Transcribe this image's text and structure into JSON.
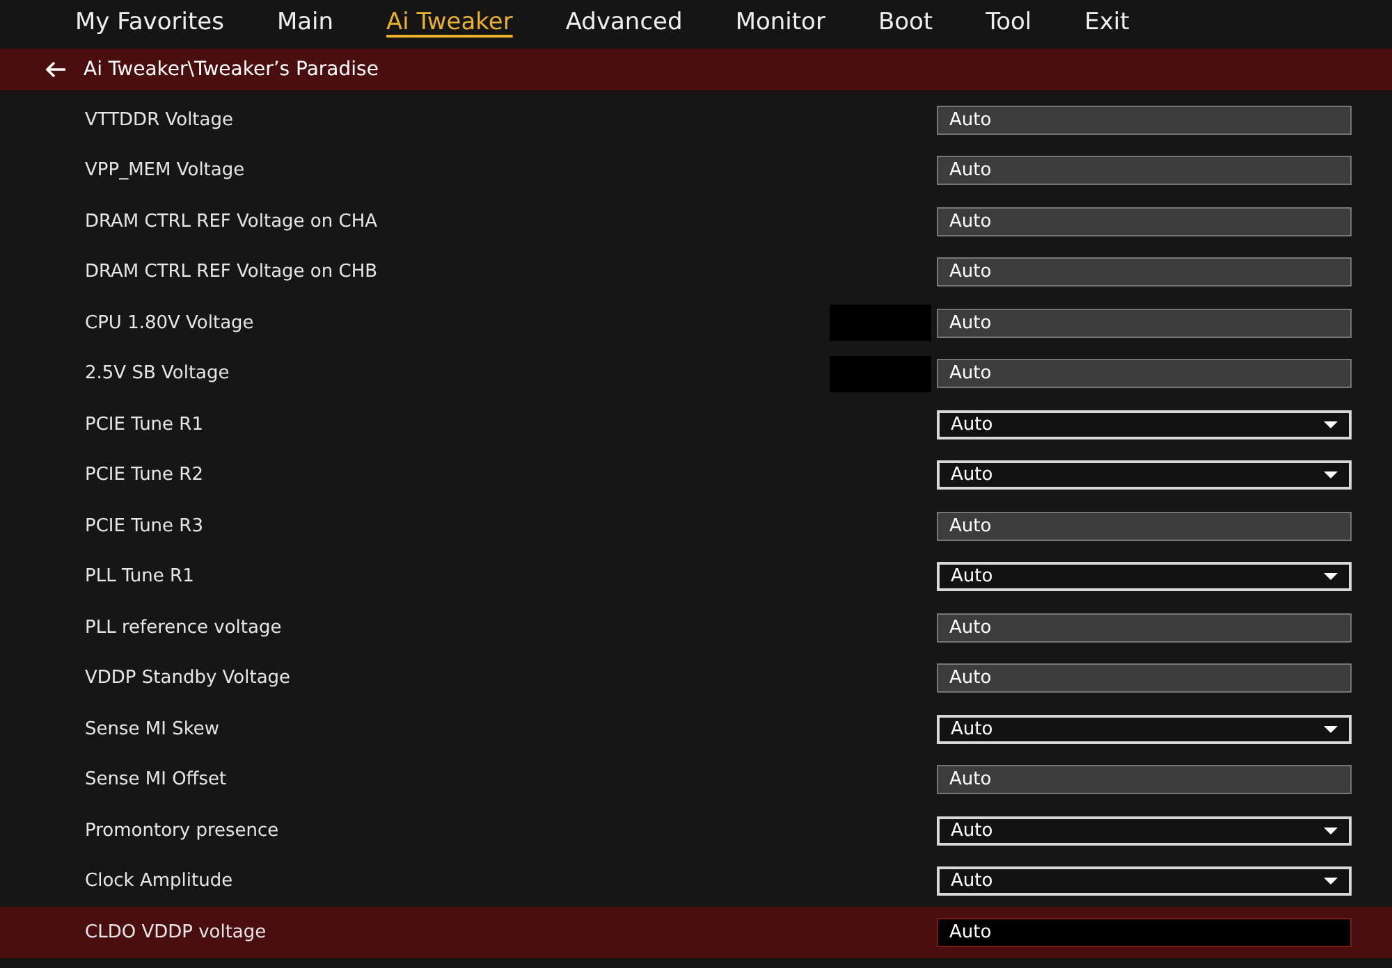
{
  "menu": [
    {
      "label": "My Favorites",
      "selected": false
    },
    {
      "label": "Main",
      "selected": false
    },
    {
      "label": "Ai Tweaker",
      "selected": true
    },
    {
      "label": "Advanced",
      "selected": false
    },
    {
      "label": "Monitor",
      "selected": false
    },
    {
      "label": "Boot",
      "selected": false
    },
    {
      "label": "Tool",
      "selected": false
    },
    {
      "label": "Exit",
      "selected": false
    }
  ],
  "breadcrumb": "Ai Tweaker\\Tweaker’s Paradise",
  "settings": [
    {
      "label": "VTTDDR Voltage",
      "kind": "text",
      "value": "Auto",
      "blank_box": false,
      "selected": false
    },
    {
      "label": "VPP_MEM Voltage",
      "kind": "text",
      "value": "Auto",
      "blank_box": false,
      "selected": false
    },
    {
      "label": "DRAM CTRL REF Voltage on CHA",
      "kind": "text",
      "value": "Auto",
      "blank_box": false,
      "selected": false
    },
    {
      "label": "DRAM CTRL REF Voltage on CHB",
      "kind": "text",
      "value": "Auto",
      "blank_box": false,
      "selected": false
    },
    {
      "label": "CPU 1.80V Voltage",
      "kind": "text",
      "value": "Auto",
      "blank_box": true,
      "selected": false
    },
    {
      "label": "2.5V SB Voltage",
      "kind": "text",
      "value": "Auto",
      "blank_box": true,
      "selected": false
    },
    {
      "label": "PCIE Tune R1",
      "kind": "dropdown",
      "value": "Auto",
      "blank_box": false,
      "selected": false
    },
    {
      "label": "PCIE Tune R2",
      "kind": "dropdown",
      "value": "Auto",
      "blank_box": false,
      "selected": false
    },
    {
      "label": "PCIE Tune R3",
      "kind": "text",
      "value": "Auto",
      "blank_box": false,
      "selected": false
    },
    {
      "label": "PLL Tune R1",
      "kind": "dropdown",
      "value": "Auto",
      "blank_box": false,
      "selected": false
    },
    {
      "label": "PLL reference voltage",
      "kind": "text",
      "value": "Auto",
      "blank_box": false,
      "selected": false
    },
    {
      "label": "VDDP Standby Voltage",
      "kind": "text",
      "value": "Auto",
      "blank_box": false,
      "selected": false
    },
    {
      "label": "Sense MI Skew",
      "kind": "dropdown",
      "value": "Auto",
      "blank_box": false,
      "selected": false
    },
    {
      "label": "Sense MI Offset",
      "kind": "text",
      "value": "Auto",
      "blank_box": false,
      "selected": false
    },
    {
      "label": "Promontory presence",
      "kind": "dropdown",
      "value": "Auto",
      "blank_box": false,
      "selected": false
    },
    {
      "label": "Clock Amplitude",
      "kind": "dropdown",
      "value": "Auto",
      "blank_box": false,
      "selected": false
    },
    {
      "label": "CLDO VDDP voltage",
      "kind": "text",
      "value": "Auto",
      "blank_box": false,
      "selected": true
    }
  ]
}
